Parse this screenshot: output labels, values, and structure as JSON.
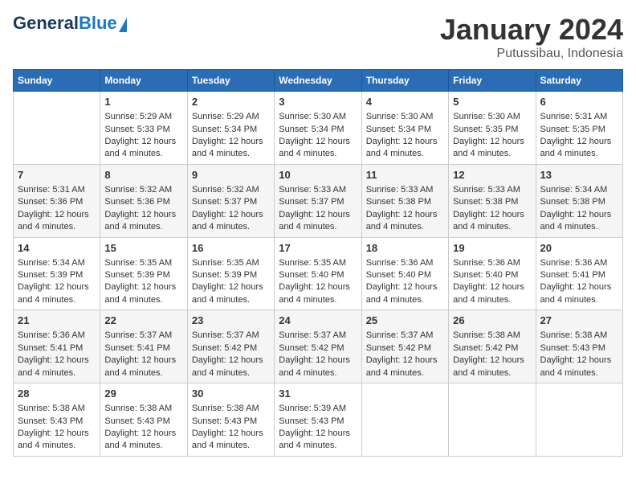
{
  "header": {
    "logo_general": "General",
    "logo_blue": "Blue",
    "month_title": "January 2024",
    "location": "Putussibau, Indonesia"
  },
  "days_of_week": [
    "Sunday",
    "Monday",
    "Tuesday",
    "Wednesday",
    "Thursday",
    "Friday",
    "Saturday"
  ],
  "weeks": [
    [
      {
        "day": "",
        "sunrise": "",
        "sunset": "",
        "daylight": ""
      },
      {
        "day": "1",
        "sunrise": "Sunrise: 5:29 AM",
        "sunset": "Sunset: 5:33 PM",
        "daylight": "Daylight: 12 hours and 4 minutes."
      },
      {
        "day": "2",
        "sunrise": "Sunrise: 5:29 AM",
        "sunset": "Sunset: 5:34 PM",
        "daylight": "Daylight: 12 hours and 4 minutes."
      },
      {
        "day": "3",
        "sunrise": "Sunrise: 5:30 AM",
        "sunset": "Sunset: 5:34 PM",
        "daylight": "Daylight: 12 hours and 4 minutes."
      },
      {
        "day": "4",
        "sunrise": "Sunrise: 5:30 AM",
        "sunset": "Sunset: 5:34 PM",
        "daylight": "Daylight: 12 hours and 4 minutes."
      },
      {
        "day": "5",
        "sunrise": "Sunrise: 5:30 AM",
        "sunset": "Sunset: 5:35 PM",
        "daylight": "Daylight: 12 hours and 4 minutes."
      },
      {
        "day": "6",
        "sunrise": "Sunrise: 5:31 AM",
        "sunset": "Sunset: 5:35 PM",
        "daylight": "Daylight: 12 hours and 4 minutes."
      }
    ],
    [
      {
        "day": "7",
        "sunrise": "Sunrise: 5:31 AM",
        "sunset": "Sunset: 5:36 PM",
        "daylight": "Daylight: 12 hours and 4 minutes."
      },
      {
        "day": "8",
        "sunrise": "Sunrise: 5:32 AM",
        "sunset": "Sunset: 5:36 PM",
        "daylight": "Daylight: 12 hours and 4 minutes."
      },
      {
        "day": "9",
        "sunrise": "Sunrise: 5:32 AM",
        "sunset": "Sunset: 5:37 PM",
        "daylight": "Daylight: 12 hours and 4 minutes."
      },
      {
        "day": "10",
        "sunrise": "Sunrise: 5:33 AM",
        "sunset": "Sunset: 5:37 PM",
        "daylight": "Daylight: 12 hours and 4 minutes."
      },
      {
        "day": "11",
        "sunrise": "Sunrise: 5:33 AM",
        "sunset": "Sunset: 5:38 PM",
        "daylight": "Daylight: 12 hours and 4 minutes."
      },
      {
        "day": "12",
        "sunrise": "Sunrise: 5:33 AM",
        "sunset": "Sunset: 5:38 PM",
        "daylight": "Daylight: 12 hours and 4 minutes."
      },
      {
        "day": "13",
        "sunrise": "Sunrise: 5:34 AM",
        "sunset": "Sunset: 5:38 PM",
        "daylight": "Daylight: 12 hours and 4 minutes."
      }
    ],
    [
      {
        "day": "14",
        "sunrise": "Sunrise: 5:34 AM",
        "sunset": "Sunset: 5:39 PM",
        "daylight": "Daylight: 12 hours and 4 minutes."
      },
      {
        "day": "15",
        "sunrise": "Sunrise: 5:35 AM",
        "sunset": "Sunset: 5:39 PM",
        "daylight": "Daylight: 12 hours and 4 minutes."
      },
      {
        "day": "16",
        "sunrise": "Sunrise: 5:35 AM",
        "sunset": "Sunset: 5:39 PM",
        "daylight": "Daylight: 12 hours and 4 minutes."
      },
      {
        "day": "17",
        "sunrise": "Sunrise: 5:35 AM",
        "sunset": "Sunset: 5:40 PM",
        "daylight": "Daylight: 12 hours and 4 minutes."
      },
      {
        "day": "18",
        "sunrise": "Sunrise: 5:36 AM",
        "sunset": "Sunset: 5:40 PM",
        "daylight": "Daylight: 12 hours and 4 minutes."
      },
      {
        "day": "19",
        "sunrise": "Sunrise: 5:36 AM",
        "sunset": "Sunset: 5:40 PM",
        "daylight": "Daylight: 12 hours and 4 minutes."
      },
      {
        "day": "20",
        "sunrise": "Sunrise: 5:36 AM",
        "sunset": "Sunset: 5:41 PM",
        "daylight": "Daylight: 12 hours and 4 minutes."
      }
    ],
    [
      {
        "day": "21",
        "sunrise": "Sunrise: 5:36 AM",
        "sunset": "Sunset: 5:41 PM",
        "daylight": "Daylight: 12 hours and 4 minutes."
      },
      {
        "day": "22",
        "sunrise": "Sunrise: 5:37 AM",
        "sunset": "Sunset: 5:41 PM",
        "daylight": "Daylight: 12 hours and 4 minutes."
      },
      {
        "day": "23",
        "sunrise": "Sunrise: 5:37 AM",
        "sunset": "Sunset: 5:42 PM",
        "daylight": "Daylight: 12 hours and 4 minutes."
      },
      {
        "day": "24",
        "sunrise": "Sunrise: 5:37 AM",
        "sunset": "Sunset: 5:42 PM",
        "daylight": "Daylight: 12 hours and 4 minutes."
      },
      {
        "day": "25",
        "sunrise": "Sunrise: 5:37 AM",
        "sunset": "Sunset: 5:42 PM",
        "daylight": "Daylight: 12 hours and 4 minutes."
      },
      {
        "day": "26",
        "sunrise": "Sunrise: 5:38 AM",
        "sunset": "Sunset: 5:42 PM",
        "daylight": "Daylight: 12 hours and 4 minutes."
      },
      {
        "day": "27",
        "sunrise": "Sunrise: 5:38 AM",
        "sunset": "Sunset: 5:43 PM",
        "daylight": "Daylight: 12 hours and 4 minutes."
      }
    ],
    [
      {
        "day": "28",
        "sunrise": "Sunrise: 5:38 AM",
        "sunset": "Sunset: 5:43 PM",
        "daylight": "Daylight: 12 hours and 4 minutes."
      },
      {
        "day": "29",
        "sunrise": "Sunrise: 5:38 AM",
        "sunset": "Sunset: 5:43 PM",
        "daylight": "Daylight: 12 hours and 4 minutes."
      },
      {
        "day": "30",
        "sunrise": "Sunrise: 5:38 AM",
        "sunset": "Sunset: 5:43 PM",
        "daylight": "Daylight: 12 hours and 4 minutes."
      },
      {
        "day": "31",
        "sunrise": "Sunrise: 5:39 AM",
        "sunset": "Sunset: 5:43 PM",
        "daylight": "Daylight: 12 hours and 4 minutes."
      },
      {
        "day": "",
        "sunrise": "",
        "sunset": "",
        "daylight": ""
      },
      {
        "day": "",
        "sunrise": "",
        "sunset": "",
        "daylight": ""
      },
      {
        "day": "",
        "sunrise": "",
        "sunset": "",
        "daylight": ""
      }
    ]
  ]
}
